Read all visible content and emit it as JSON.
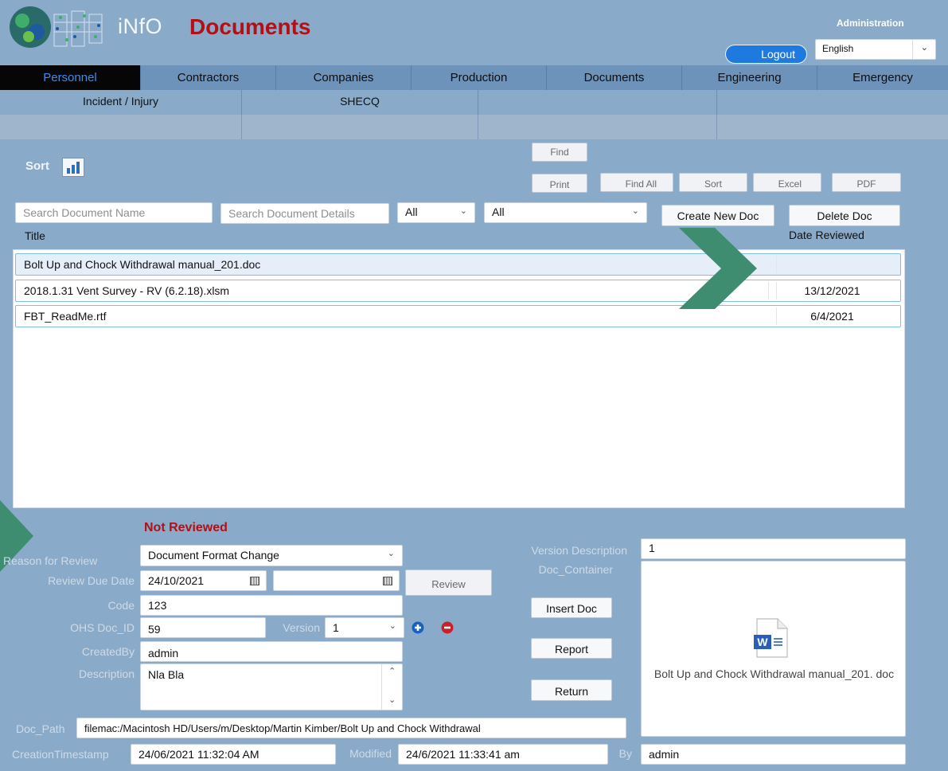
{
  "header": {
    "logo_text": "iNfO",
    "app_title": "Documents",
    "admin_label": "Administration",
    "logout_label": "Logout",
    "language": "English"
  },
  "nav": {
    "primary": [
      "Personnel",
      "Contractors",
      "Companies",
      "Production",
      "Documents",
      "Engineering",
      "Emergency"
    ],
    "active": "Personnel",
    "secondary": [
      "Incident / Injury",
      "SHECQ",
      "",
      ""
    ]
  },
  "toolbar": {
    "sort_label": "Sort",
    "find": "Find",
    "print": "Print",
    "find_all": "Find All",
    "sort": "Sort",
    "excel": "Excel",
    "pdf": "PDF"
  },
  "filters": {
    "search_name_placeholder": "Search Document Name",
    "search_details_placeholder": "Search Document Details",
    "select1": "All",
    "select2": "All",
    "create_new": "Create New Doc",
    "delete": "Delete Doc"
  },
  "list": {
    "col_title": "Title",
    "col_date": "Date Reviewed",
    "rows": [
      {
        "title": "Bolt Up and Chock Withdrawal manual_201.doc",
        "date": ""
      },
      {
        "title": "2018.1.31 Vent Survey - RV (6.2.18).xlsm",
        "date": "13/12/2021"
      },
      {
        "title": "FBT_ReadMe.rtf",
        "date": "6/4/2021"
      }
    ]
  },
  "detail": {
    "status": "Not Reviewed",
    "reason_label": "Reason for Review",
    "reason_value": "Document Format Change",
    "due_label": "Review Due Date",
    "due_value": "24/10/2021",
    "due_value2": "",
    "review_button": "Review",
    "code_label": "Code",
    "code_value": "123",
    "ohs_label": "OHS Doc_ID",
    "ohs_value": "59",
    "version_label": "Version",
    "version_value": "1",
    "createdby_label": "CreatedBy",
    "createdby_value": "admin",
    "desc_label": "Description",
    "desc_value": "Nla Bla",
    "docpath_label": "Doc_Path",
    "docpath_value": "filemac:/Macintosh HD/Users/m/Desktop/Martin Kimber/Bolt Up and Chock Withdrawal",
    "created_label": "CreationTimestamp",
    "created_value": "24/06/2021 11:32:04 AM",
    "modified_label": "Modified",
    "modified_value": "24/6/2021 11:33:41 am",
    "by_label": "By",
    "by_value": "admin",
    "version_desc_label": "Version Description",
    "version_desc_value": "1",
    "doc_container_label": "Doc_Container",
    "insert_doc": "Insert Doc",
    "report": "Report",
    "return": "Return",
    "doc_caption": "Bolt Up and Chock Withdrawal manual_201. doc"
  },
  "colors": {
    "background": "#89aac8",
    "accent_red": "#b30f14",
    "nav_active": "#060606",
    "arrow_green": "#3f8d70"
  }
}
